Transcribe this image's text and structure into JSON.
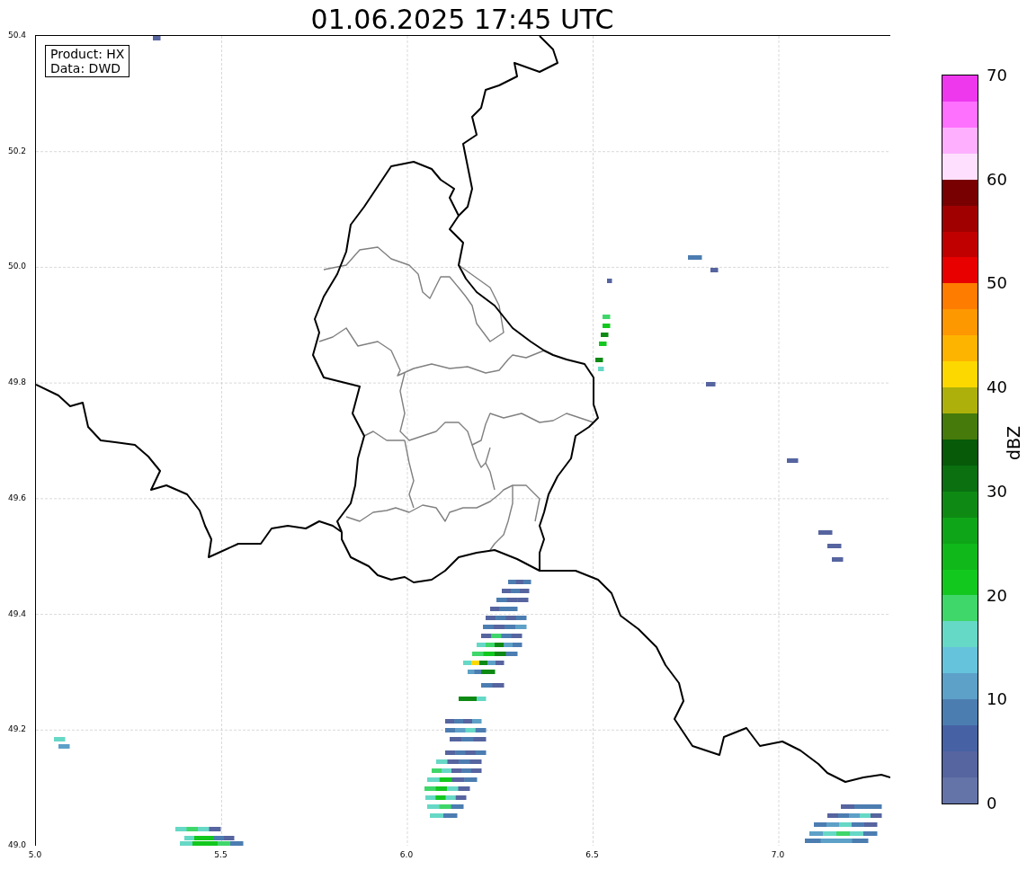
{
  "title": "01.06.2025 17:45 UTC",
  "info_box": [
    "Product: HX",
    "Data: DWD"
  ],
  "map": {
    "xticks": [
      "5.0",
      "5.5",
      "6.0",
      "6.5",
      "7.0"
    ],
    "yticks": [
      "50.4",
      "50.2",
      "50.0",
      "49.8",
      "49.6",
      "49.4",
      "49.2",
      "49.0"
    ]
  },
  "colorbar": {
    "label": "dBZ",
    "ticks": [
      "70",
      "60",
      "50",
      "40",
      "30",
      "20",
      "10",
      "0"
    ],
    "bands": [
      {
        "color": "#ee38ee"
      },
      {
        "color": "#fe70fe"
      },
      {
        "color": "#feb0fe"
      },
      {
        "color": "#fee0fe"
      },
      {
        "color": "#780000"
      },
      {
        "color": "#a00000"
      },
      {
        "color": "#c00000"
      },
      {
        "color": "#e80000"
      },
      {
        "color": "#fe7c00"
      },
      {
        "color": "#fd9800"
      },
      {
        "color": "#fdb400"
      },
      {
        "color": "#fdd800"
      },
      {
        "color": "#adb00a"
      },
      {
        "color": "#467a0a"
      },
      {
        "color": "#065a08"
      },
      {
        "color": "#0a7010"
      },
      {
        "color": "#0e8a14"
      },
      {
        "color": "#0fa518"
      },
      {
        "color": "#10b81a"
      },
      {
        "color": "#12c81e"
      },
      {
        "color": "#3fd66a"
      },
      {
        "color": "#66d8c6"
      },
      {
        "color": "#66c3dc"
      },
      {
        "color": "#5da0c8"
      },
      {
        "color": "#4c7db1"
      },
      {
        "color": "#4762a4"
      },
      {
        "color": "#56649f"
      },
      {
        "color": "#6473a8"
      }
    ]
  }
}
